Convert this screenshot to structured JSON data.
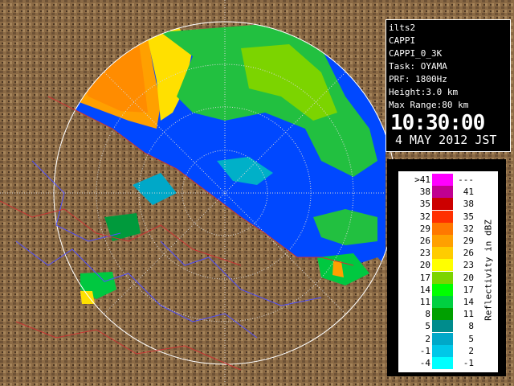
{
  "info": {
    "lines": [
      "ilts2",
      "CAPPI",
      "CAPPI_0_3K",
      "Task: OYAMA",
      "PRF: 1800Hz",
      "Height:3.0 km",
      "Max Range:80 km"
    ],
    "time": "10:30:00",
    "date": "4 MAY 2012 JST"
  },
  "legend": {
    "title": "Reflectivity in dBZ",
    "rows": [
      {
        "lo": ">41",
        "hi": "---",
        "color": "#ff00ff"
      },
      {
        "lo": "38",
        "hi": "41",
        "color": "#c00090"
      },
      {
        "lo": "35",
        "hi": "38",
        "color": "#cc0000"
      },
      {
        "lo": "32",
        "hi": "35",
        "color": "#ff3000"
      },
      {
        "lo": "29",
        "hi": "32",
        "color": "#ff7800"
      },
      {
        "lo": "26",
        "hi": "29",
        "color": "#ffa000"
      },
      {
        "lo": "23",
        "hi": "26",
        "color": "#ffcc00"
      },
      {
        "lo": "20",
        "hi": "23",
        "color": "#ffff00"
      },
      {
        "lo": "17",
        "hi": "20",
        "color": "#7cd400"
      },
      {
        "lo": "14",
        "hi": "17",
        "color": "#00ff00"
      },
      {
        "lo": "11",
        "hi": "14",
        "color": "#00d040"
      },
      {
        "lo": "8",
        "hi": "11",
        "color": "#00a000"
      },
      {
        "lo": "5",
        "hi": "8",
        "color": "#008c8c"
      },
      {
        "lo": "2",
        "hi": "5",
        "color": "#00a8c8"
      },
      {
        "lo": "-1",
        "hi": "2",
        "color": "#00c8e8"
      },
      {
        "lo": "-4",
        "hi": "-1",
        "color": "#00ffff"
      }
    ]
  },
  "map": {
    "land_color": "#8b6a45",
    "sea_color": "#0040ff",
    "range_ring_color": "#cfcfcf",
    "river_color": "#5050ff",
    "border_color": "#cc3333"
  }
}
